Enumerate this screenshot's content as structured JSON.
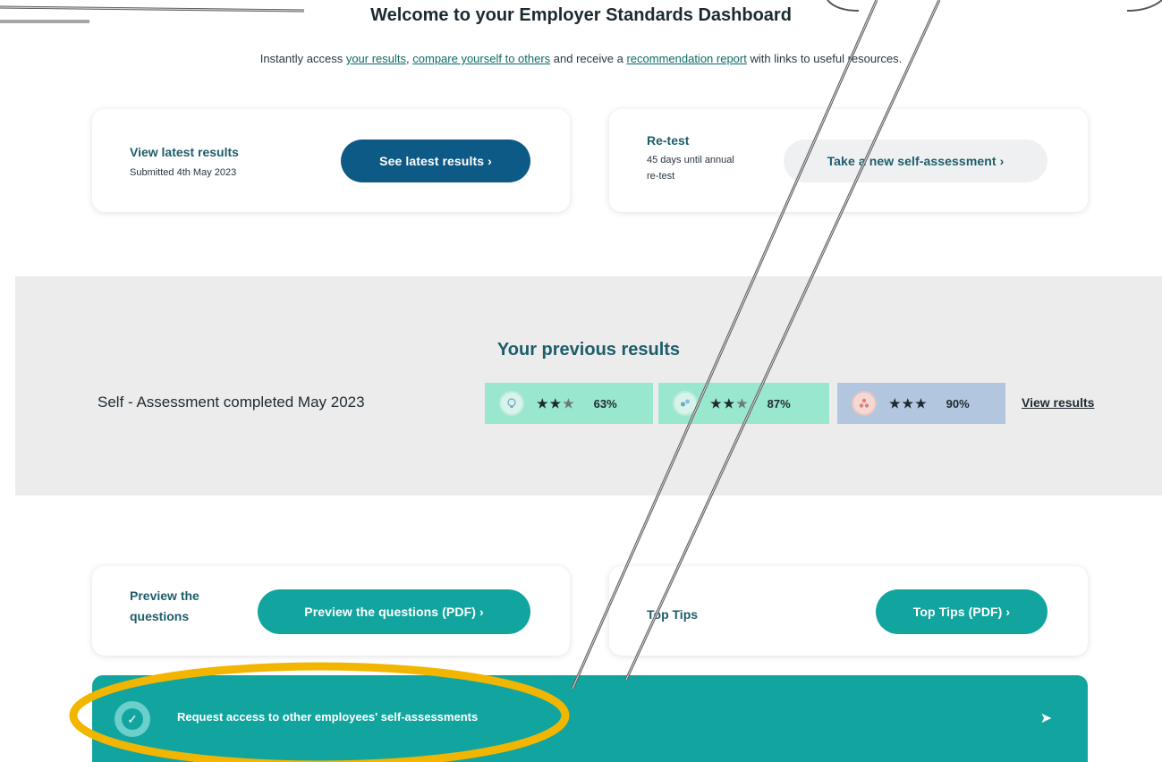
{
  "header": {
    "title": "Welcome to your Employer Standards Dashboard",
    "intro_prefix": "Instantly access ",
    "link_results": "your results",
    "intro_comma": ", ",
    "link_compare": "compare yourself to others",
    "intro_middle": " and receive a ",
    "link_report": "recommendation report",
    "intro_suffix": " with links to useful resources."
  },
  "latest": {
    "label": "View latest results",
    "submitted": "Submitted 4th May 2023",
    "button": "See latest results ›"
  },
  "retest": {
    "label": "Re-test",
    "days_line1": "45 days until annual",
    "days_line2": "re-test",
    "button": "Take a new self-assessment ›"
  },
  "previous": {
    "title": "Your previous results",
    "assessment_label": "Self - Assessment completed May 2023",
    "scores": [
      {
        "stars_filled": "★★",
        "stars_empty": "★",
        "percent": "63%",
        "color": "#9ae7d0",
        "icon": "bulb-icon"
      },
      {
        "stars_filled": "★★",
        "stars_empty": "★",
        "percent": "87%",
        "color": "#9ae7d0",
        "icon": "people-icon"
      },
      {
        "stars_filled": "★★★",
        "stars_empty": "",
        "percent": "90%",
        "color": "#b2c6e0",
        "icon": "network-icon"
      }
    ],
    "view_results": "View results"
  },
  "preview": {
    "label_line1": "Preview the",
    "label_line2": "questions",
    "button": "Preview the questions (PDF) ›"
  },
  "tips": {
    "label": "Top Tips",
    "button": "Top Tips (PDF) ›"
  },
  "request": {
    "text": "Request access to other employees' self-assessments"
  },
  "colors": {
    "teal": "#12a5a0",
    "dark_blue": "#0e5a86",
    "highlight": "#f2b600"
  }
}
